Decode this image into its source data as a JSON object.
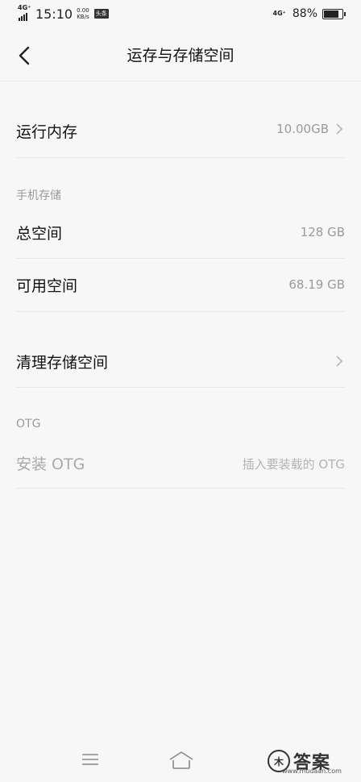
{
  "status_bar": {
    "network_left": "4G⁺",
    "time": "15:10",
    "speed_value": "0.00",
    "speed_unit": "KB/s",
    "app_tag": "头条",
    "network_right": "4G⁺",
    "battery_percent": "88%",
    "battery_level": 0.88
  },
  "header": {
    "title": "运存与存储空间"
  },
  "ram": {
    "label": "运行内存",
    "value": "10.00GB"
  },
  "storage_section": {
    "title": "手机存储",
    "total_label": "总空间",
    "total_value": "128 GB",
    "available_label": "可用空间",
    "available_value": "68.19 GB"
  },
  "clean": {
    "label": "清理存储空间"
  },
  "otg_section": {
    "title": "OTG",
    "install_label": "安装 OTG",
    "install_hint": "插入要装载的 OTG"
  },
  "watermark": {
    "logo_char": "木",
    "text": "答案",
    "url": "www.mudaan.com"
  }
}
